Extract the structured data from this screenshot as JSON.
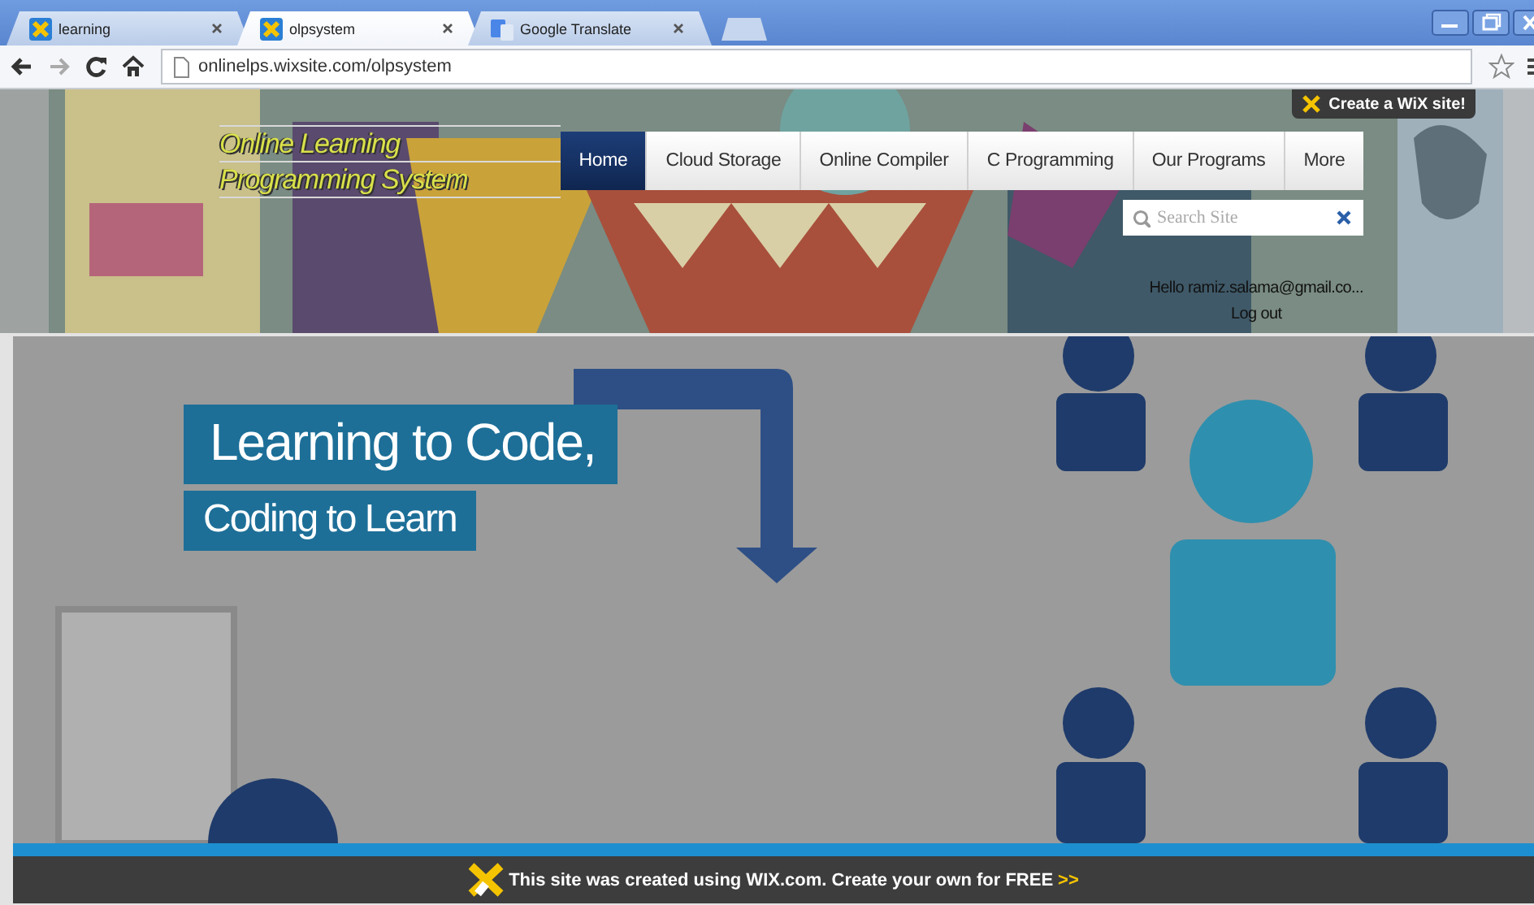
{
  "browser": {
    "tabs": [
      {
        "label": "learning",
        "selected": false,
        "kind": "site"
      },
      {
        "label": "olpsystem",
        "selected": true,
        "kind": "site"
      },
      {
        "label": "Google Translate",
        "selected": false,
        "kind": "translate"
      }
    ],
    "url": "onlinelps.wixsite.com/olpsystem"
  },
  "wix_badge": {
    "label": "Create a WiX site!"
  },
  "site": {
    "title_lines": [
      "Online Learning",
      "Programming System"
    ],
    "nav": [
      {
        "label": "Home",
        "selected": true
      },
      {
        "label": "Cloud Storage",
        "selected": false
      },
      {
        "label": "Online Compiler",
        "selected": false
      },
      {
        "label": "C Programming",
        "selected": false
      },
      {
        "label": "Our Programs",
        "selected": false
      },
      {
        "label": "More",
        "selected": false
      }
    ],
    "search": {
      "placeholder": "Search Site"
    },
    "greeting": "Hello ramiz.salama@gmail.co...",
    "logout": "Log out"
  },
  "hero": {
    "headlines": [
      "Learning to Code,",
      "Coding to Learn"
    ]
  },
  "footer": {
    "text": "This site was created using WIX.com. Create your own for FREE",
    "link": ">>"
  }
}
